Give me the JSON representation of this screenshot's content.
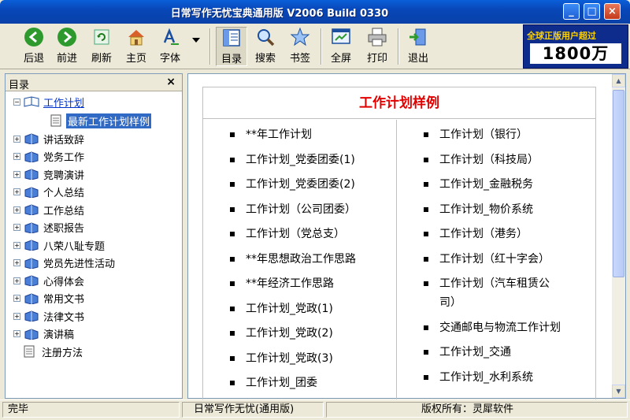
{
  "window": {
    "title": "日常写作无忧宝典通用版 V2006 Build 0330"
  },
  "toolbar": {
    "back": "后退",
    "forward": "前进",
    "refresh": "刷新",
    "home": "主页",
    "font": "字体",
    "toc": "目录",
    "search": "搜索",
    "bookmark": "书签",
    "fullscreen": "全屏",
    "print": "打印",
    "exit": "退出"
  },
  "banner": {
    "line1": "全球正版用户超过",
    "line2": "1800万"
  },
  "sidebar": {
    "title": "目录",
    "close": "×",
    "items": [
      {
        "label": "工作计划"
      },
      {
        "label": "最新工作计划样例"
      },
      {
        "label": "讲话致辞"
      },
      {
        "label": "党务工作"
      },
      {
        "label": "竞聘演讲"
      },
      {
        "label": "个人总结"
      },
      {
        "label": "工作总结"
      },
      {
        "label": "述职报告"
      },
      {
        "label": "八荣八耻专题"
      },
      {
        "label": "党员先进性活动"
      },
      {
        "label": "心得体会"
      },
      {
        "label": "常用文书"
      },
      {
        "label": "法律文书"
      },
      {
        "label": "演讲稿"
      },
      {
        "label": "注册方法"
      }
    ]
  },
  "main": {
    "heading": "工作计划样例",
    "left": [
      "**年工作计划",
      "工作计划_党委团委(1)",
      "工作计划_党委团委(2)",
      "工作计划（公司团委）",
      "工作计划（党总支）",
      "**年思想政治工作思路",
      "**年经济工作思路",
      "工作计划_党政(1)",
      "工作计划_党政(2)",
      "工作计划_党政(3)",
      "工作计划_团委"
    ],
    "right": [
      "工作计划（银行）",
      "工作计划（科技局）",
      "工作计划_金融税务",
      "工作计划_物价系统",
      "工作计划（港务）",
      "工作计划（红十字会）",
      "工作计划（汽车租赁公",
      "司）",
      "交通邮电与物流工作计划",
      "工作计划_交通",
      "工作计划_水利系统"
    ]
  },
  "status": {
    "state": "完毕",
    "app": "日常写作无忧(通用版)",
    "copyright": "版权所有：灵犀软件"
  }
}
